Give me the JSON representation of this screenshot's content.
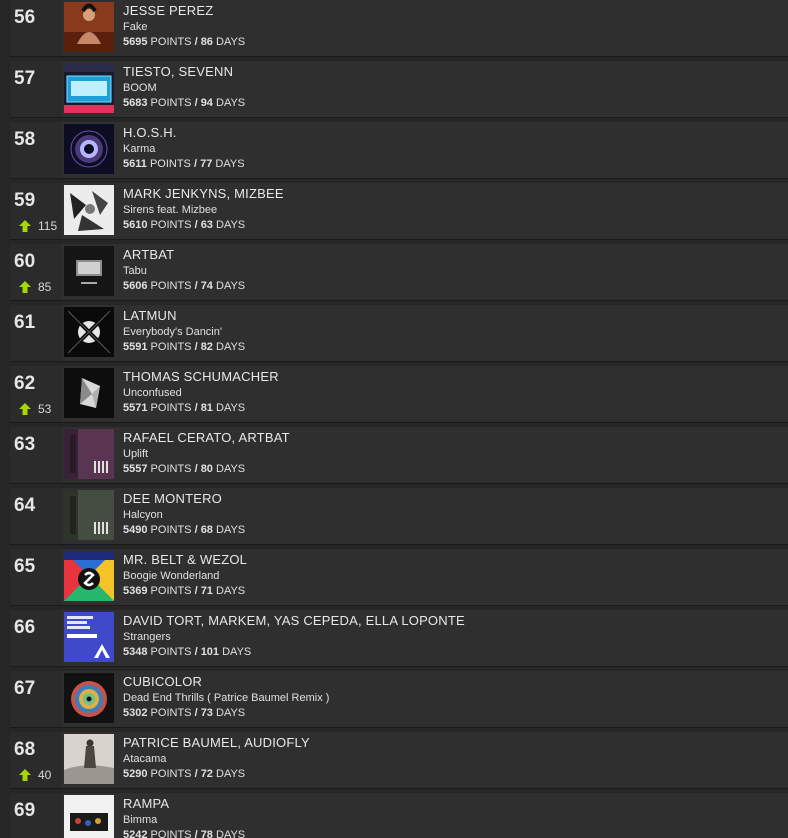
{
  "chart": {
    "points_label": "POINTS",
    "days_label": "DAYS",
    "separator": "/",
    "entries": [
      {
        "rank": "56",
        "artist": "JESSE PEREZ",
        "title": "Fake",
        "points": "5695",
        "days": "86",
        "move": "",
        "art_icon": "cover-woman-portrait-icon"
      },
      {
        "rank": "57",
        "artist": "TIESTO, SEVENN",
        "title": "BOOM",
        "points": "5683",
        "days": "94",
        "move": "",
        "art_icon": "cover-boom-icon"
      },
      {
        "rank": "58",
        "artist": "H.O.S.H.",
        "title": "Karma",
        "points": "5611",
        "days": "77",
        "move": "",
        "art_icon": "cover-glowing-circle-icon"
      },
      {
        "rank": "59",
        "artist": "MARK JENKYNS, MIZBEE",
        "title": "Sirens feat. Mizbee",
        "points": "5610",
        "days": "63",
        "move": "115",
        "art_icon": "cover-graphic-bw-icon"
      },
      {
        "rank": "60",
        "artist": "ARTBAT",
        "title": "Tabu",
        "points": "5606",
        "days": "74",
        "move": "85",
        "art_icon": "cover-instant-icon"
      },
      {
        "rank": "61",
        "artist": "LATMUN",
        "title": "Everybody's Dancin'",
        "points": "5591",
        "days": "82",
        "move": "",
        "art_icon": "cover-x-logo-icon"
      },
      {
        "rank": "62",
        "artist": "THOMAS SCHUMACHER",
        "title": "Unconfused",
        "points": "5571",
        "days": "81",
        "move": "53",
        "art_icon": "cover-geometric-face-icon"
      },
      {
        "rank": "63",
        "artist": "RAFAEL CERATO, ARTBAT",
        "title": "Uplift",
        "points": "5557",
        "days": "80",
        "move": "",
        "art_icon": "cover-the-four-purple-icon"
      },
      {
        "rank": "64",
        "artist": "DEE MONTERO",
        "title": "Halcyon",
        "points": "5490",
        "days": "68",
        "move": "",
        "art_icon": "cover-the-four-green-icon"
      },
      {
        "rank": "65",
        "artist": "MR. BELT & WEZOL",
        "title": "Boogie Wonderland",
        "points": "5369",
        "days": "71",
        "move": "",
        "art_icon": "cover-spinnin-icon"
      },
      {
        "rank": "66",
        "artist": "DAVID TORT, MARKEM, YAS CEPEDA, ELLA LOPONTE",
        "title": "Strangers",
        "points": "5348",
        "days": "101",
        "move": "",
        "art_icon": "cover-strangers-icon"
      },
      {
        "rank": "67",
        "artist": "CUBICOLOR",
        "title": "Dead End Thrills ( Patrice Baumel Remix )",
        "points": "5302",
        "days": "73",
        "move": "",
        "art_icon": "cover-colorful-circle-icon"
      },
      {
        "rank": "68",
        "artist": "PATRICE BAUMEL, AUDIOFLY",
        "title": "Atacama",
        "points": "5290",
        "days": "72",
        "move": "40",
        "art_icon": "cover-desert-figure-icon"
      },
      {
        "rank": "69",
        "artist": "RAMPA",
        "title": "Bimma",
        "points": "5242",
        "days": "78",
        "move": "",
        "art_icon": "cover-figures-icon"
      }
    ]
  },
  "colors": {
    "up_arrow": "#a6d609",
    "row_bg": "#2f2f2f",
    "page_bg": "#262626"
  }
}
